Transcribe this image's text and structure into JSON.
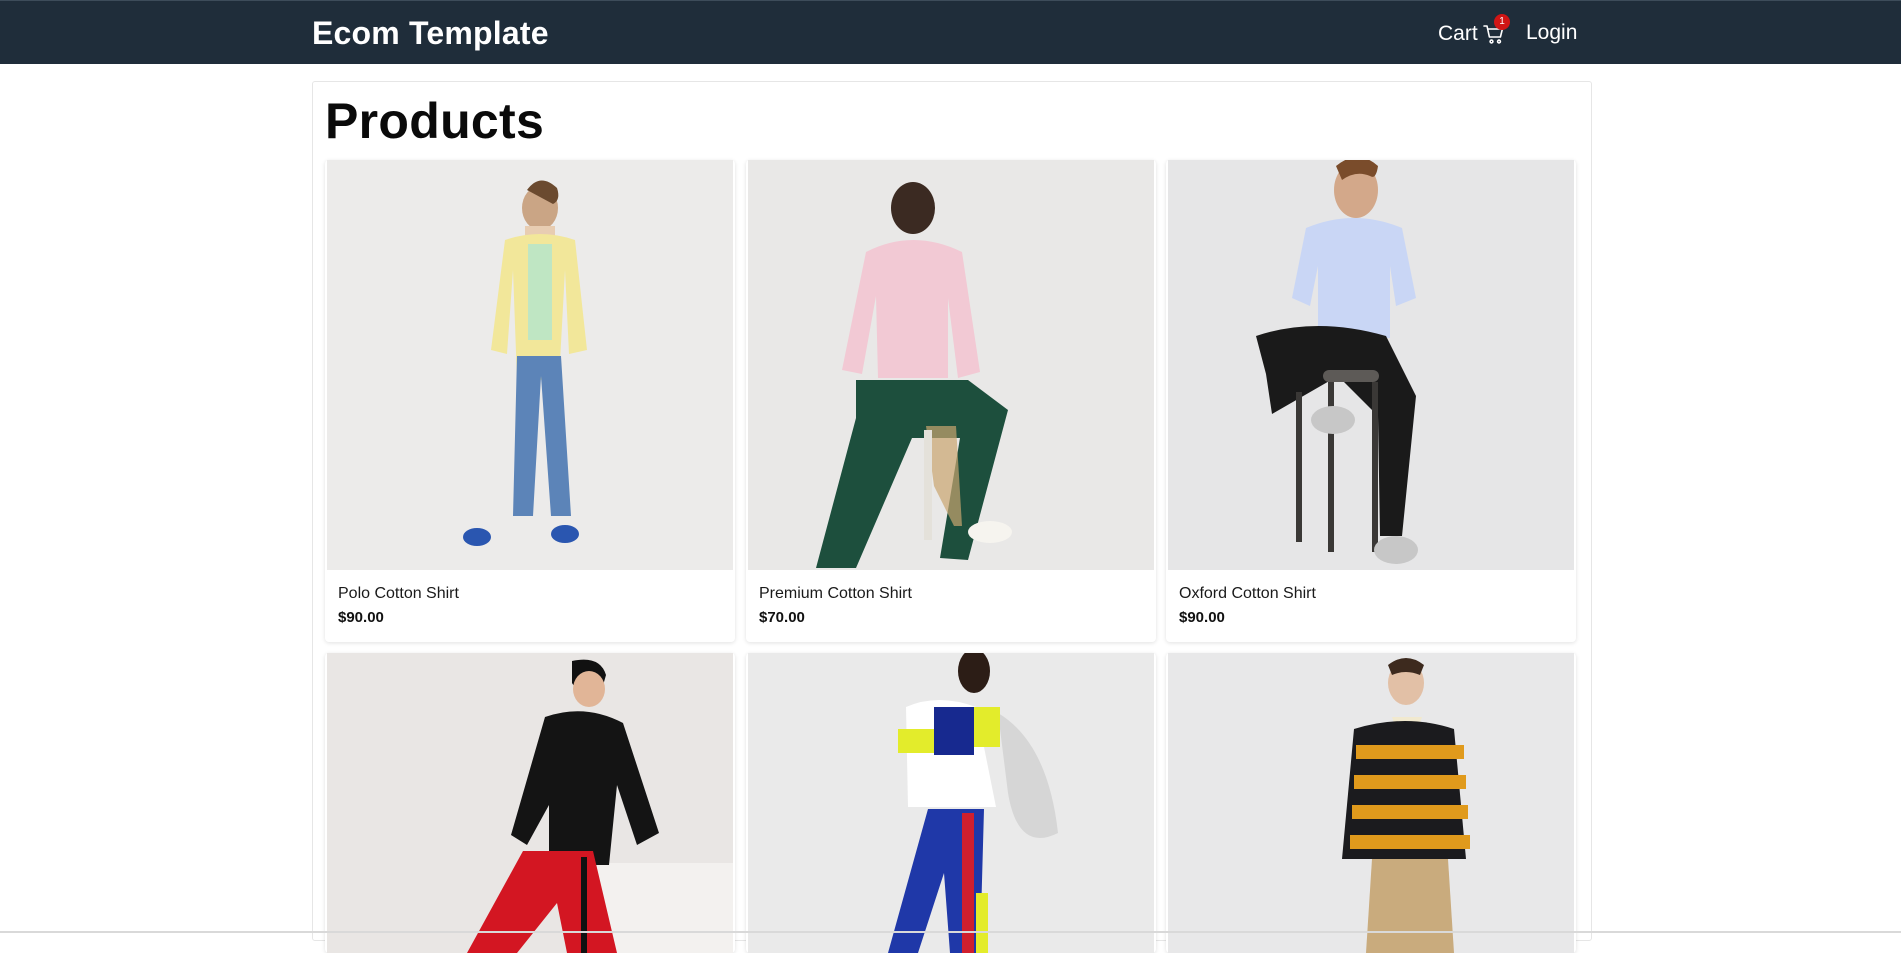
{
  "navbar": {
    "brand": "Ecom Template",
    "cart_label": "Cart",
    "cart_count": "1",
    "login_label": "Login",
    "background": "#1f2d3a",
    "badge_color": "#d01515"
  },
  "page": {
    "title": "Products"
  },
  "products": [
    {
      "name": "Polo Cotton Shirt",
      "price": "$90.00"
    },
    {
      "name": "Premium Cotton Shirt",
      "price": "$70.00"
    },
    {
      "name": "Oxford Cotton Shirt",
      "price": "$90.00"
    },
    {
      "name": "",
      "price": ""
    },
    {
      "name": "",
      "price": ""
    },
    {
      "name": "",
      "price": ""
    }
  ],
  "icons": {
    "cart": "cart-icon"
  }
}
